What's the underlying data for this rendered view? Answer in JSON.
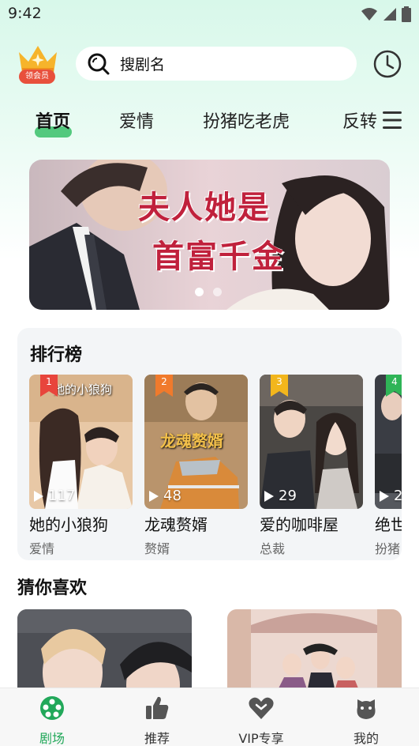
{
  "status_bar": {
    "time": "9:42"
  },
  "header": {
    "vip_label": "领会员",
    "search_placeholder": "搜剧名"
  },
  "tabs": [
    {
      "label": "首页",
      "active": true
    },
    {
      "label": "爱情",
      "active": false
    },
    {
      "label": "扮猪吃老虎",
      "active": false
    },
    {
      "label": "反转",
      "active": false
    }
  ],
  "banner": {
    "title_line1": "夫人她是",
    "title_line2": "首富千金",
    "page_count": 2,
    "current_page": 1
  },
  "ranking": {
    "title": "排行榜",
    "items": [
      {
        "rank": "1",
        "name": "她的小狼狗",
        "genre": "爱情",
        "plays": "117",
        "poster_text": "她的小狼狗",
        "badge_color": "#e8453c"
      },
      {
        "rank": "2",
        "name": "龙魂赘婿",
        "genre": "赘婿",
        "plays": "48",
        "poster_text": "龙魂赘婿",
        "badge_color": "#f07a2c"
      },
      {
        "rank": "3",
        "name": "爱的咖啡屋",
        "genre": "总裁",
        "plays": "29",
        "poster_text": "",
        "badge_color": "#f2b61c"
      },
      {
        "rank": "4",
        "name": "绝世",
        "genre": "扮猪",
        "plays": "2",
        "poster_text": "",
        "badge_color": "#2fb457"
      }
    ]
  },
  "recommend": {
    "title": "猜你喜欢"
  },
  "bottom_nav": [
    {
      "label": "剧场",
      "icon": "theater-icon",
      "active": true
    },
    {
      "label": "推荐",
      "icon": "thumbs-up-icon",
      "active": false
    },
    {
      "label": "VIP专享",
      "icon": "vip-heart-icon",
      "active": false
    },
    {
      "label": "我的",
      "icon": "profile-face-icon",
      "active": false
    }
  ],
  "colors": {
    "accent": "#22a85a",
    "tab_indicator": "#53c97e",
    "vip_badge": "#e8503c"
  }
}
